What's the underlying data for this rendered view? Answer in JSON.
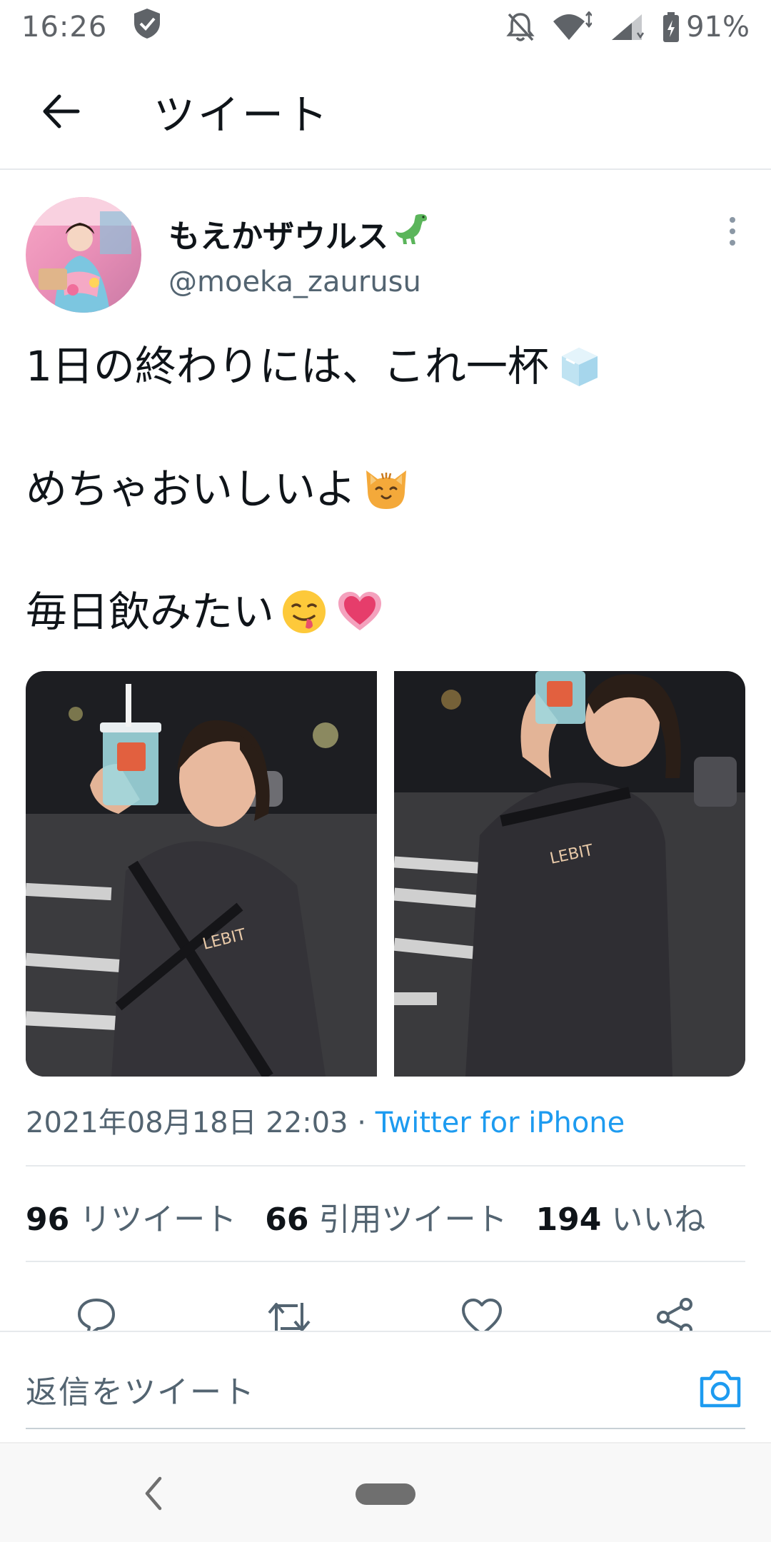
{
  "status_bar": {
    "time": "16:26",
    "battery": "91%",
    "icons": [
      "shield-icon",
      "bell-off-icon",
      "wifi-icon",
      "signal-icon",
      "battery-icon"
    ]
  },
  "app_bar": {
    "title": "ツイート",
    "back_icon": "arrow-left-icon"
  },
  "tweet": {
    "display_name": "もえかザウルス",
    "name_emoji": "🦕",
    "handle": "@moeka_zaurusu",
    "lines": [
      {
        "text": "1日の終わりには、これ一杯",
        "emoji": "ice-cube"
      },
      {
        "text": "めちゃおいしいよ",
        "emoji": "cat-face"
      },
      {
        "text": "毎日飲みたい",
        "emoji": "yum-face,heart"
      }
    ],
    "timestamp": "2021年08月18日 22:03 · ",
    "source": "Twitter for iPhone"
  },
  "stats": {
    "retweets_count": "96",
    "retweets_label": "リツイート",
    "quotes_count": "66",
    "quotes_label": "引用ツイート",
    "likes_count": "194",
    "likes_label": "いいね"
  },
  "actions": [
    "reply-icon",
    "retweet-icon",
    "like-icon",
    "share-icon"
  ],
  "reply_bar": {
    "placeholder": "返信をツイート"
  },
  "colors": {
    "accent": "#1d9bf0",
    "text": "#0f1419",
    "secondary": "#536471",
    "divider": "#e6e9ec"
  }
}
